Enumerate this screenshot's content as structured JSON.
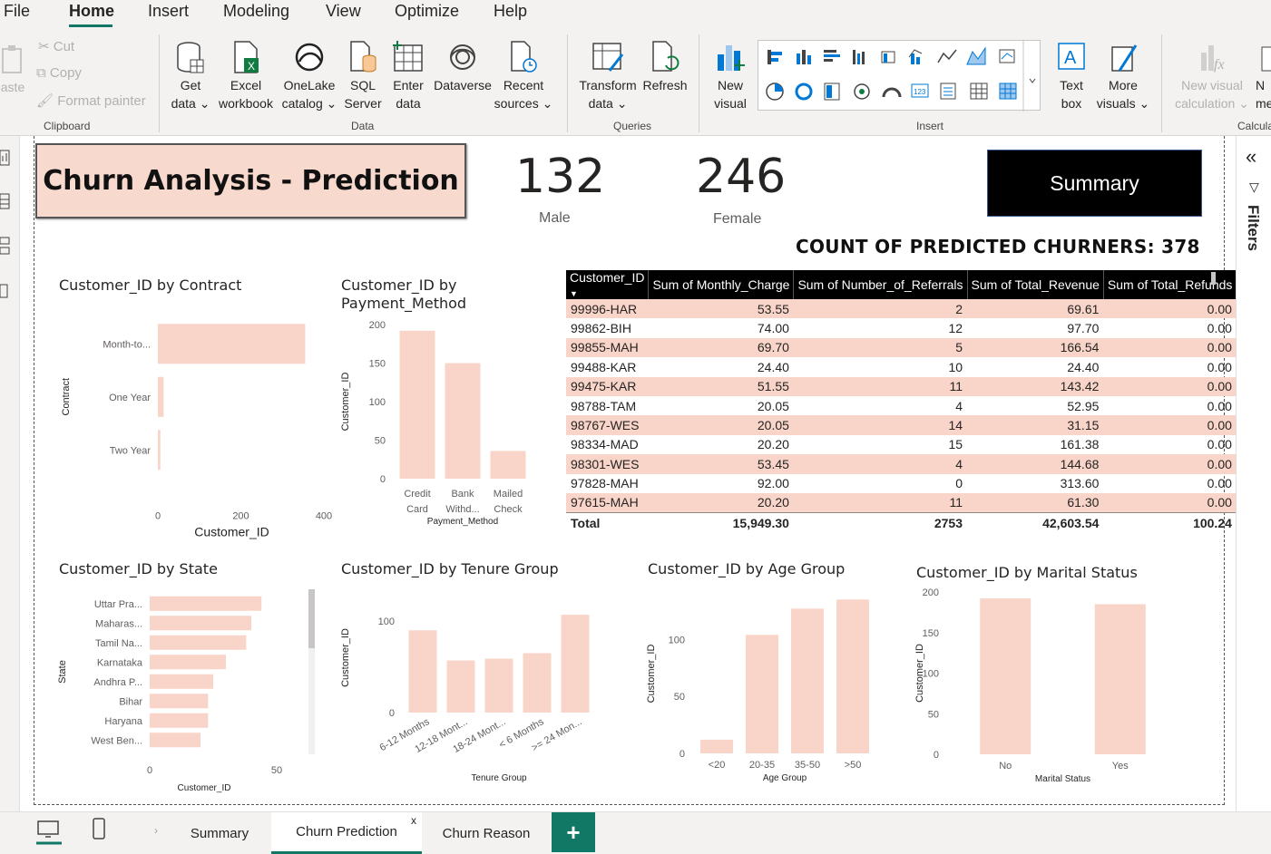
{
  "menu": {
    "items": [
      "File",
      "Home",
      "Insert",
      "Modeling",
      "View",
      "Optimize",
      "Help"
    ],
    "active": "Home"
  },
  "ribbon": {
    "clipboard": {
      "paste": "aste",
      "cut": "Cut",
      "copy": "Copy",
      "format_painter": "Format painter",
      "label": "Clipboard"
    },
    "data": {
      "get_data": [
        "Get",
        "data"
      ],
      "excel": [
        "Excel",
        "workbook"
      ],
      "onelake": [
        "OneLake",
        "catalog"
      ],
      "sql": [
        "SQL",
        "Server"
      ],
      "enter": [
        "Enter",
        "data"
      ],
      "dataverse": [
        "Dataverse"
      ],
      "recent": [
        "Recent",
        "sources"
      ],
      "label": "Data"
    },
    "queries": {
      "transform": [
        "Transform",
        "data"
      ],
      "refresh": [
        "Refresh"
      ],
      "label": "Queries"
    },
    "insert": {
      "new_visual": [
        "New",
        "visual"
      ],
      "text_box": [
        "Text",
        "box"
      ],
      "more_visuals": [
        "More",
        "visuals"
      ],
      "label": "Insert"
    },
    "calculations": {
      "new_visual_calc": [
        "New visual",
        "calculation"
      ],
      "more": [
        "N",
        "me"
      ],
      "label": "Calcula"
    }
  },
  "filters_pane": {
    "label": "Filters"
  },
  "report": {
    "title": "Churn Analysis - Prediction",
    "kpi_male": {
      "value": "132",
      "label": "Male"
    },
    "kpi_female": {
      "value": "246",
      "label": "Female"
    },
    "summary_button": "Summary",
    "churn_count": "COUNT OF PREDICTED CHURNERS: 378"
  },
  "table": {
    "columns": [
      "Customer_ID",
      "Sum of Monthly_Charge",
      "Sum of Number_of_Referrals",
      "Sum of Total_Revenue",
      "Sum of Total_Refunds"
    ],
    "rows": [
      [
        "99996-HAR",
        "53.55",
        "2",
        "69.61",
        "0.00"
      ],
      [
        "99862-BIH",
        "74.00",
        "12",
        "97.70",
        "0.00"
      ],
      [
        "99855-MAH",
        "69.70",
        "5",
        "166.54",
        "0.00"
      ],
      [
        "99488-KAR",
        "24.40",
        "10",
        "24.40",
        "0.00"
      ],
      [
        "99475-KAR",
        "51.55",
        "11",
        "143.42",
        "0.00"
      ],
      [
        "98788-TAM",
        "20.05",
        "4",
        "52.95",
        "0.00"
      ],
      [
        "98767-WES",
        "20.05",
        "14",
        "31.15",
        "0.00"
      ],
      [
        "98334-MAD",
        "20.20",
        "15",
        "161.38",
        "0.00"
      ],
      [
        "98301-WES",
        "53.45",
        "4",
        "144.68",
        "0.00"
      ],
      [
        "97828-MAH",
        "92.00",
        "0",
        "313.60",
        "0.00"
      ],
      [
        "97615-MAH",
        "20.20",
        "11",
        "61.30",
        "0.00"
      ]
    ],
    "total": [
      "Total",
      "15,949.30",
      "2753",
      "42,603.54",
      "100.24"
    ]
  },
  "chart_data": [
    {
      "type": "bar",
      "orientation": "horizontal",
      "title": "Customer_ID by Contract",
      "xlabel": "Customer_ID",
      "ylabel": "Contract",
      "categories": [
        "Month-to...",
        "One Year",
        "Two Year"
      ],
      "values": [
        355,
        14,
        6
      ],
      "xticks": [
        "0",
        "200",
        "400"
      ],
      "xlim": [
        0,
        400
      ]
    },
    {
      "type": "bar",
      "title": "Customer_ID by Payment_Method",
      "xlabel": "Payment_Method",
      "ylabel": "Customer_ID",
      "categories": [
        [
          "Credit",
          "Card"
        ],
        [
          "Bank",
          "Withd..."
        ],
        [
          "Mailed",
          "Check"
        ]
      ],
      "values": [
        192,
        150,
        36
      ],
      "yticks": [
        "0",
        "50",
        "100",
        "150",
        "200"
      ],
      "ylim": [
        0,
        200
      ]
    },
    {
      "type": "bar",
      "orientation": "horizontal",
      "title": "Customer_ID by State",
      "xlabel": "Customer_ID",
      "ylabel": "State",
      "categories": [
        "Uttar Pra...",
        "Maharas...",
        "Tamil Na...",
        "Karnataka",
        "Andhra P...",
        "Bihar",
        "Haryana",
        "West Ben..."
      ],
      "values": [
        44,
        40,
        38,
        30,
        25,
        23,
        23,
        20
      ],
      "xticks": [
        "0",
        "50"
      ],
      "xlim": [
        0,
        50
      ]
    },
    {
      "type": "bar",
      "title": "Customer_ID by Tenure Group",
      "xlabel": "Tenure Group",
      "ylabel": "Customer_ID",
      "categories": [
        "6-12 Months",
        "12-18 Mont...",
        "18-24 Mont...",
        "< 6 Months",
        ">= 24 Mon..."
      ],
      "values": [
        90,
        57,
        59,
        65,
        107
      ],
      "yticks": [
        "0",
        "100"
      ],
      "ylim": [
        0,
        120
      ]
    },
    {
      "type": "bar",
      "title": "Customer_ID by Age Group",
      "xlabel": "Age Group",
      "ylabel": "Customer_ID",
      "categories": [
        "<20",
        "20-35",
        "35-50",
        ">50"
      ],
      "values": [
        12,
        104,
        127,
        135
      ],
      "yticks": [
        "0",
        "50",
        "100"
      ],
      "ylim": [
        0,
        140
      ]
    },
    {
      "type": "bar",
      "title": "Customer_ID by Marital Status",
      "xlabel": "Marital Status",
      "ylabel": "Customer_ID",
      "categories": [
        "No",
        "Yes"
      ],
      "values": [
        192,
        185
      ],
      "yticks": [
        "0",
        "50",
        "100",
        "150",
        "200"
      ],
      "ylim": [
        0,
        200
      ]
    }
  ],
  "page_tabs": {
    "items": [
      "Summary",
      "Churn Prediction",
      "Churn Reason"
    ],
    "active": "Churn Prediction",
    "close_glyph": "x",
    "add": "+"
  },
  "colors": {
    "accent": "#117865",
    "bar": "#f9d4c8",
    "title_bg": "#f8d9cd"
  }
}
